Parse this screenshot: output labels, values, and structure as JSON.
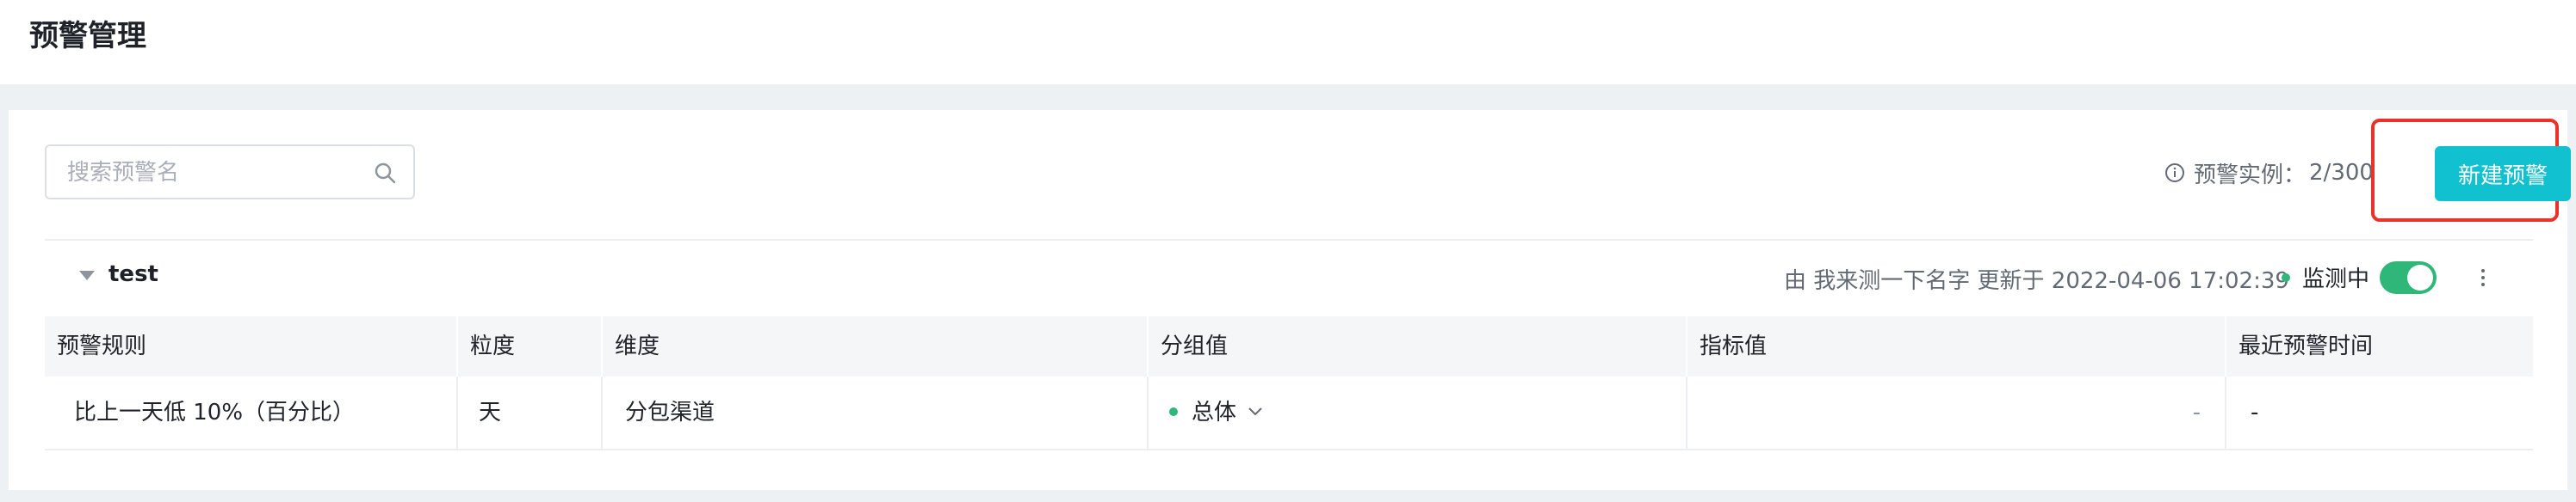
{
  "page": {
    "title": "预警管理"
  },
  "search": {
    "placeholder": "搜索预警名",
    "value": ""
  },
  "quota": {
    "label": "预警实例：",
    "value": "2/300"
  },
  "toolbar": {
    "new_label": "新建预警"
  },
  "group": {
    "name": "test",
    "meta": "由 我来测一下名字 更新于 2022-04-06 17:02:39",
    "status": "监测中",
    "enabled": true
  },
  "table": {
    "headers": [
      "预警规则",
      "粒度",
      "维度",
      "分组值",
      "指标值",
      "最近预警时间"
    ],
    "rows": [
      {
        "rule": "比上一天低 10%（百分比）",
        "granularity": "天",
        "dimension": "分包渠道",
        "group_value": "总体",
        "metric": "-",
        "last_alert": "-"
      }
    ]
  },
  "colors": {
    "accent": "#12c1cf",
    "status": "#2fb679",
    "highlight": "#e8322a"
  },
  "icons": [
    "search-icon",
    "info-icon",
    "caret-down-icon",
    "more-icon",
    "chevron-down-icon"
  ]
}
